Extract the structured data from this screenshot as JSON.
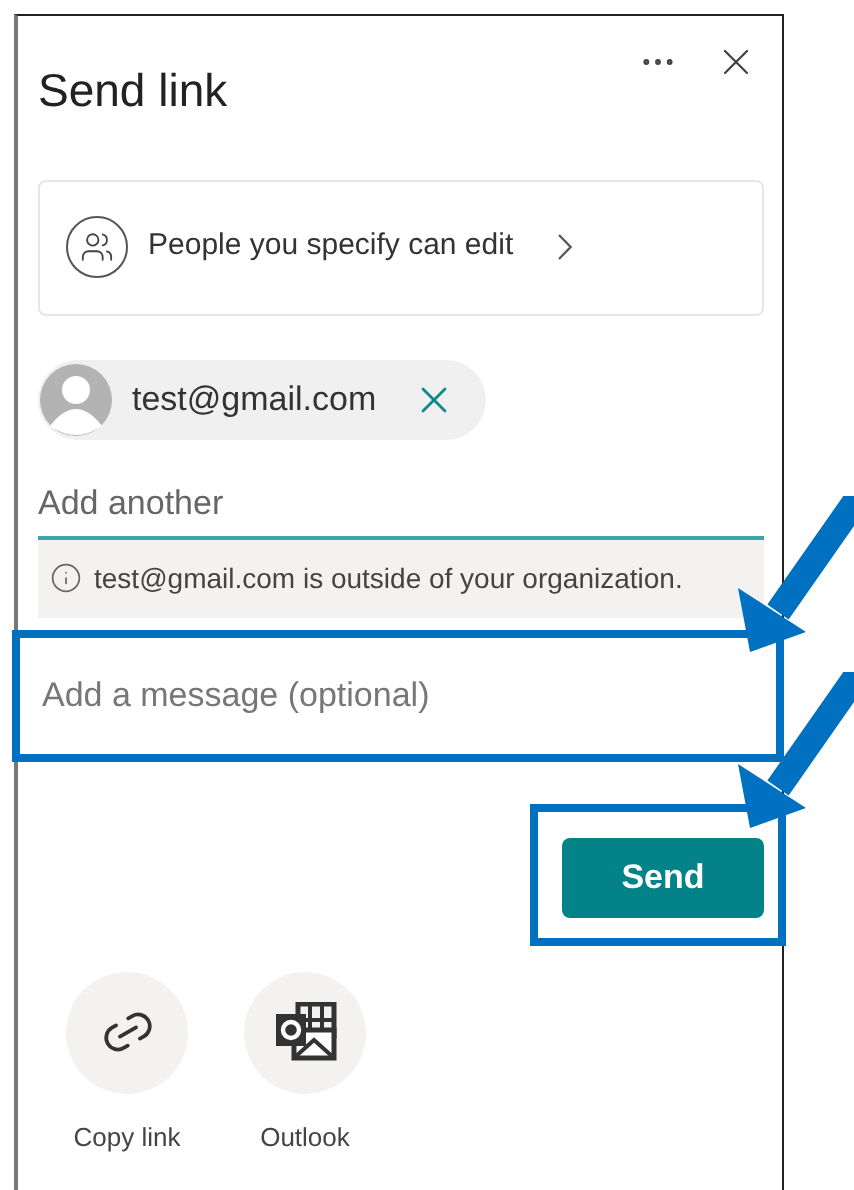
{
  "panel": {
    "title": "Send link"
  },
  "permission": {
    "label": "People you specify can edit"
  },
  "recipients": [
    {
      "email": "test@gmail.com"
    }
  ],
  "add_field": {
    "placeholder": "Add another"
  },
  "notice": {
    "text": "test@gmail.com is outside of your organization."
  },
  "message_field": {
    "placeholder": "Add a message (optional)",
    "highlighted": true
  },
  "send_button": {
    "label": "Send",
    "highlighted": true
  },
  "share_options": [
    {
      "kind": "copy",
      "label": "Copy link"
    },
    {
      "kind": "outlook",
      "label": "Outlook"
    }
  ]
}
